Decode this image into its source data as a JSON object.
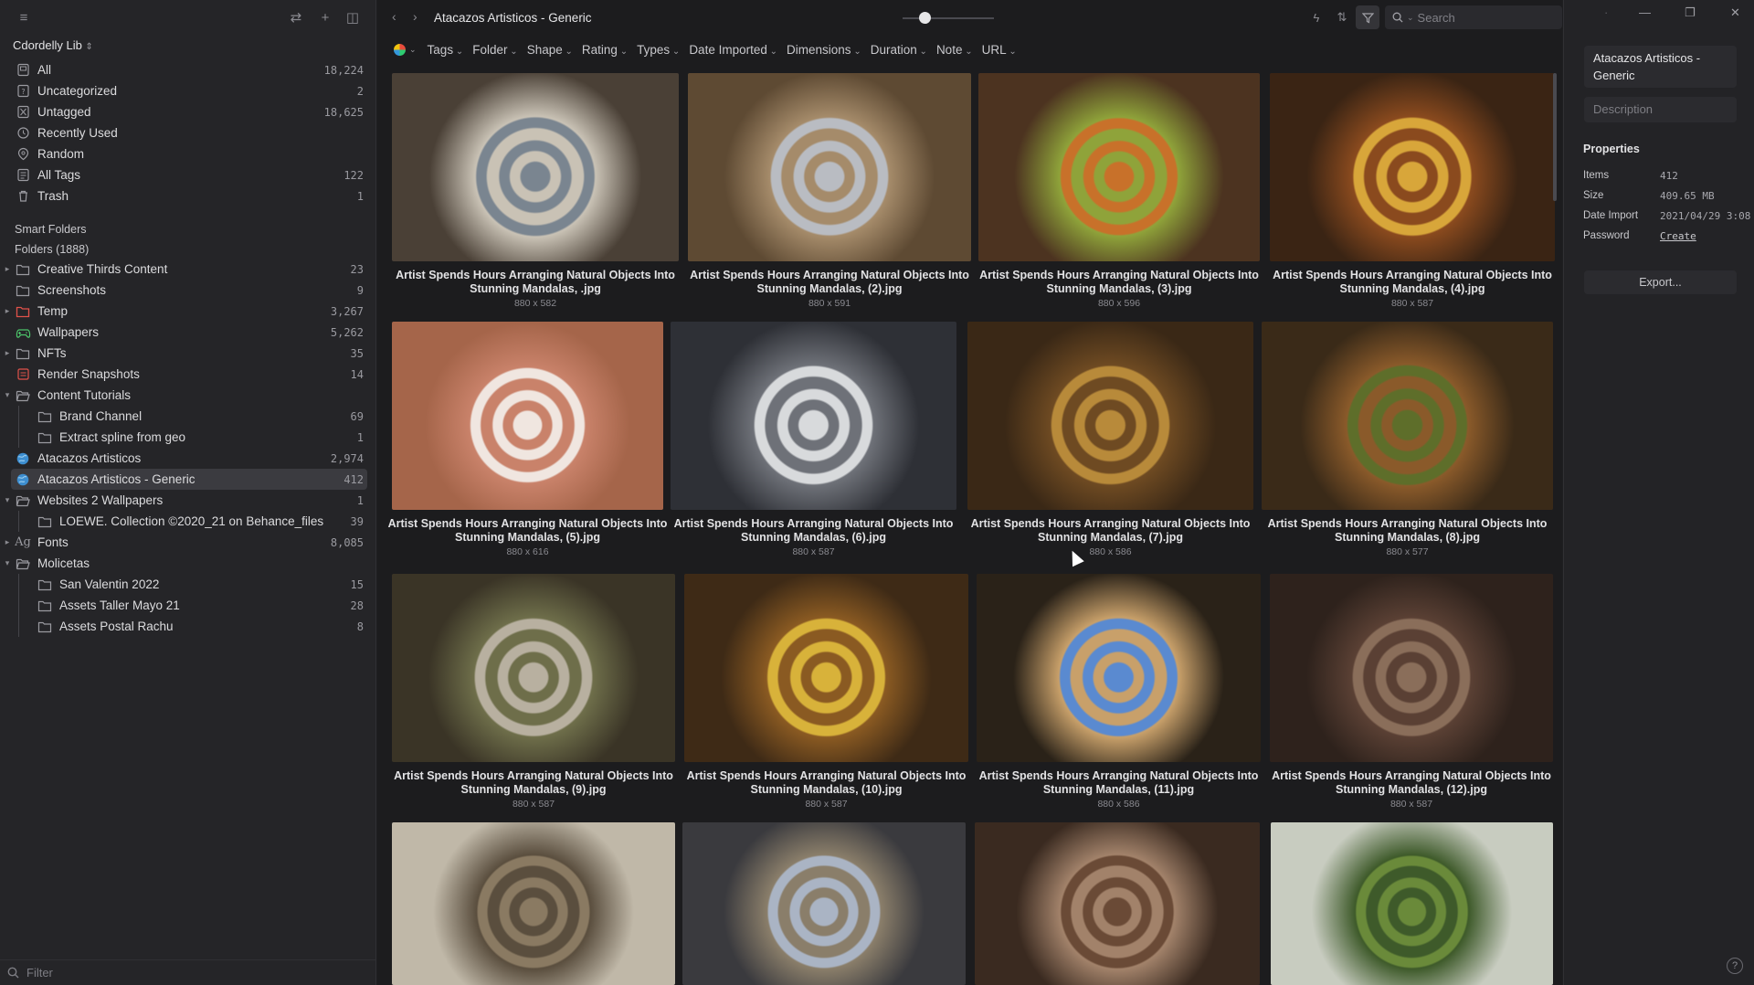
{
  "library": {
    "name": "Cdordelly Lib"
  },
  "sidebar": {
    "top_items": [
      {
        "label": "All",
        "count": "18,224",
        "icon": "all-items-icon"
      },
      {
        "label": "Uncategorized",
        "count": "2",
        "icon": "uncategorized-icon"
      },
      {
        "label": "Untagged",
        "count": "18,625",
        "icon": "untagged-icon"
      },
      {
        "label": "Recently Used",
        "count": "",
        "icon": "clock-icon"
      },
      {
        "label": "Random",
        "count": "",
        "icon": "random-icon"
      },
      {
        "label": "All Tags",
        "count": "122",
        "icon": "tags-icon"
      },
      {
        "label": "Trash",
        "count": "1",
        "icon": "trash-icon"
      }
    ],
    "smart_folders_label": "Smart Folders",
    "folders_label": "Folders (1888)",
    "folders": [
      {
        "label": "Creative Thirds Content",
        "count": "23",
        "caret": "▸",
        "icon": "folder"
      },
      {
        "label": "Screenshots",
        "count": "9",
        "caret": "",
        "icon": "folder"
      },
      {
        "label": "Temp",
        "count": "3,267",
        "caret": "▸",
        "icon": "folder-red"
      },
      {
        "label": "Wallpapers",
        "count": "5,262",
        "caret": "",
        "icon": "gamepad"
      },
      {
        "label": "NFTs",
        "count": "35",
        "caret": "▸",
        "icon": "folder"
      },
      {
        "label": "Render Snapshots",
        "count": "14",
        "caret": "",
        "icon": "render"
      },
      {
        "label": "Content Tutorials",
        "count": "",
        "caret": "▾",
        "icon": "folder-open"
      },
      {
        "label": "Brand Channel",
        "count": "69",
        "caret": "",
        "icon": "folder",
        "indent": 1
      },
      {
        "label": "Extract spline from geo",
        "count": "1",
        "caret": "",
        "icon": "folder",
        "indent": 1
      },
      {
        "label": "Atacazos Artisticos",
        "count": "2,974",
        "caret": "",
        "icon": "globe"
      },
      {
        "label": "Atacazos Artisticos - Generic",
        "count": "412",
        "caret": "",
        "icon": "globe",
        "selected": true
      },
      {
        "label": "Websites 2 Wallpapers",
        "count": "1",
        "caret": "▾",
        "icon": "folder-open"
      },
      {
        "label": "LOEWE. Collection ©2020_21 on Behance_files",
        "count": "39",
        "caret": "",
        "icon": "folder",
        "indent": 1
      },
      {
        "label": "Fonts",
        "count": "8,085",
        "caret": "▸",
        "icon": "font"
      },
      {
        "label": "Molicetas",
        "count": "",
        "caret": "▾",
        "icon": "folder-open"
      },
      {
        "label": "San Valentin 2022",
        "count": "15",
        "caret": "",
        "icon": "folder",
        "indent": 1
      },
      {
        "label": "Assets Taller Mayo 21",
        "count": "28",
        "caret": "",
        "icon": "folder",
        "indent": 1
      },
      {
        "label": "Assets Postal Rachu",
        "count": "8",
        "caret": "",
        "icon": "folder",
        "indent": 1
      }
    ],
    "filter_placeholder": "Filter"
  },
  "toolbar": {
    "title": "Atacazos Artisticos - Generic",
    "search_placeholder": "Search",
    "filters": [
      "Tags",
      "Folder",
      "Shape",
      "Rating",
      "Types",
      "Date Imported",
      "Dimensions",
      "Duration",
      "Note",
      "URL"
    ]
  },
  "items": [
    {
      "name": "Artist Spends Hours Arranging Natural Objects Into Stunning Mandalas, .jpg",
      "dims": "880 x 582",
      "colors": [
        "#7a8590",
        "#c9c2b5",
        "#4a4036"
      ]
    },
    {
      "name": "Artist Spends Hours Arranging Natural Objects Into Stunning Mandalas, (2).jpg",
      "dims": "880 x 591",
      "colors": [
        "#b9bcc2",
        "#a58b6a",
        "#5e4a33"
      ]
    },
    {
      "name": "Artist Spends Hours Arranging Natural Objects Into Stunning Mandalas, (3).jpg",
      "dims": "880 x 596",
      "colors": [
        "#c8712a",
        "#8fa33a",
        "#4c3320"
      ]
    },
    {
      "name": "Artist Spends Hours Arranging Natural Objects Into Stunning Mandalas, (4).jpg",
      "dims": "880 x 587",
      "colors": [
        "#d8a63a",
        "#8a4a1e",
        "#3a2414"
      ]
    },
    {
      "name": "Artist Spends Hours Arranging Natural Objects Into Stunning Mandalas, (5).jpg",
      "dims": "880 x 616",
      "colors": [
        "#f0e6e0",
        "#c9826a",
        "#a5654a"
      ]
    },
    {
      "name": "Artist Spends Hours Arranging Natural Objects Into Stunning Mandalas, (6).jpg",
      "dims": "880 x 587",
      "colors": [
        "#d8dadc",
        "#6e7178",
        "#2e3036"
      ]
    },
    {
      "name": "Artist Spends Hours Arranging Natural Objects Into Stunning Mandalas, (7).jpg",
      "dims": "880 x 586",
      "colors": [
        "#b88a3a",
        "#6e4a22",
        "#3a2816"
      ]
    },
    {
      "name": "Artist Spends Hours Arranging Natural Objects Into Stunning Mandalas, (8).jpg",
      "dims": "880 x 577",
      "colors": [
        "#5e6e2a",
        "#8a5a2a",
        "#3a2a18"
      ]
    },
    {
      "name": "Artist Spends Hours Arranging Natural Objects Into Stunning Mandalas, (9).jpg",
      "dims": "880 x 587",
      "colors": [
        "#b8b0a0",
        "#6e6e4a",
        "#3a3426"
      ]
    },
    {
      "name": "Artist Spends Hours Arranging Natural Objects Into Stunning Mandalas, (10).jpg",
      "dims": "880 x 587",
      "colors": [
        "#d8b23a",
        "#8a5a22",
        "#3e2a16"
      ]
    },
    {
      "name": "Artist Spends Hours Arranging Natural Objects Into Stunning Mandalas, (11).jpg",
      "dims": "880 x 586",
      "colors": [
        "#5a8ad0",
        "#c8a06a",
        "#2a2218"
      ]
    },
    {
      "name": "Artist Spends Hours Arranging Natural Objects Into Stunning Mandalas, (12).jpg",
      "dims": "880 x 587",
      "colors": [
        "#8a6e5a",
        "#5a4034",
        "#2e221c"
      ]
    },
    {
      "name": "",
      "dims": "",
      "colors": [
        "#8a7a62",
        "#5a4e3e",
        "#c0b8a8"
      ]
    },
    {
      "name": "",
      "dims": "",
      "colors": [
        "#aab4c4",
        "#8a7e6a",
        "#3a3a3e"
      ]
    },
    {
      "name": "",
      "dims": "",
      "colors": [
        "#6a4a36",
        "#a2826a",
        "#3a2a20"
      ]
    },
    {
      "name": "",
      "dims": "",
      "colors": [
        "#6a8a3a",
        "#3e5a2a",
        "#c8ccc0"
      ]
    }
  ],
  "inspector": {
    "title": "Atacazos Artisticos - Generic",
    "description_placeholder": "Description",
    "properties_label": "Properties",
    "props": [
      {
        "key": "Items",
        "value": "412",
        "link": false
      },
      {
        "key": "Size",
        "value": "409.65 MB",
        "link": false
      },
      {
        "key": "Date Import",
        "value": "2021/04/29 3:08",
        "link": false
      },
      {
        "key": "Password",
        "value": "Create",
        "link": true
      }
    ],
    "export_label": "Export..."
  }
}
